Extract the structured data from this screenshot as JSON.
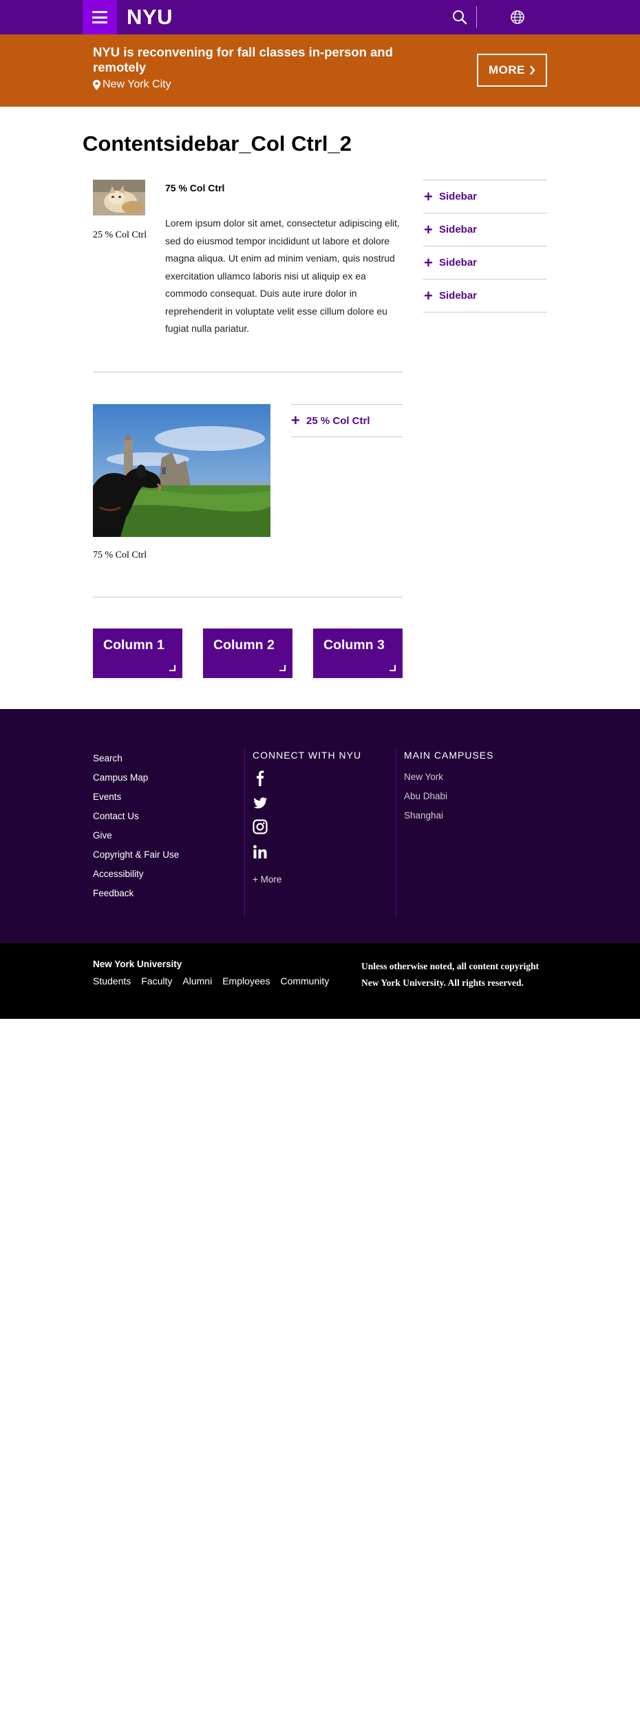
{
  "header": {
    "logo": "NYU",
    "colors": {
      "primary": "#57068c",
      "menu_button": "#8900e1",
      "alert": "#c05a0f",
      "footer": "#220337"
    },
    "icons": [
      "menu-icon",
      "search-icon",
      "globe-icon"
    ]
  },
  "alert": {
    "title": "NYU is reconvening for fall classes in-person and remotely",
    "location": "New York City",
    "more_label": "MORE",
    "icons": [
      "location-pin-icon",
      "chevron-right-icon"
    ]
  },
  "page": {
    "title": "Contentsidebar_Col Ctrl_2",
    "row1": {
      "caption": "25 % Col Ctrl",
      "heading": "75 % Col Ctrl",
      "body": "Lorem ipsum dolor sit amet, consectetur adipiscing elit, sed do eiusmod tempor incididunt ut labore et dolore magna aliqua. Ut enim ad minim veniam, quis nostrud exercitation ullamco laboris nisi ut aliquip ex ea commodo consequat. Duis aute irure dolor in reprehenderit in voluptate velit esse cillum dolore eu fugiat nulla pariatur."
    },
    "row2": {
      "caption": "75 % Col Ctrl",
      "accordion_label": "25 % Col Ctrl"
    },
    "columns": [
      "Column 1",
      "Column 2",
      "Column 3"
    ]
  },
  "sidebar": {
    "items": [
      "Sidebar",
      "Sidebar",
      "Sidebar",
      "Sidebar"
    ]
  },
  "footer": {
    "links": [
      "Search",
      "Campus Map",
      "Events",
      "Contact Us",
      "Give",
      "Copyright & Fair Use",
      "Accessibility",
      "Feedback"
    ],
    "connect_heading": "CONNECT WITH NYU",
    "social_icons": [
      "facebook-icon",
      "twitter-icon",
      "instagram-icon",
      "linkedin-icon"
    ],
    "more_label": "+ More",
    "campuses_heading": "MAIN CAMPUSES",
    "campuses": [
      "New York",
      "Abu Dhabi",
      "Shanghai"
    ]
  },
  "bottom": {
    "name": "New York University",
    "nav": [
      "Students",
      "Faculty",
      "Alumni",
      "Employees",
      "Community"
    ],
    "copyright": "Unless otherwise noted, all content copyright New York University. All rights reserved."
  }
}
